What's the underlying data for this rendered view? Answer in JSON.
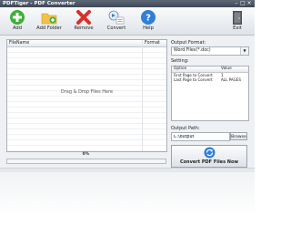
{
  "window": {
    "title": "PDFTiger - PDF Converter"
  },
  "toolbar": {
    "add": "Add",
    "add_folder": "Add Folder",
    "remove": "Remove",
    "convert": "Convert",
    "help": "Help",
    "exit": "Exit"
  },
  "file_list": {
    "columns": [
      "FileName",
      "Format"
    ],
    "placeholder": "Drag & Drop Files Here"
  },
  "progress": {
    "label": "0%",
    "value": 0
  },
  "output_format": {
    "label": "Output Format:",
    "value": "Word Files(*.doc)"
  },
  "setting": {
    "label": "Setting:",
    "columns": [
      "Option",
      "Value"
    ],
    "rows": [
      {
        "option": "First Page to Convert",
        "value": "1"
      },
      {
        "option": "Last Page to Convert",
        "value": "ALL PAGES"
      }
    ]
  },
  "output_path": {
    "label": "Output Path:",
    "value": "C:\\output",
    "browse": "Browse"
  },
  "convert_button": {
    "label": "Convert PDF Files Now"
  },
  "colors": {
    "toolbar_bg": "#eef0f3",
    "progress_fill": "#3c8ede",
    "add_green": "#3fae3a",
    "remove_red": "#d6312c",
    "help_blue": "#2f7fd8"
  }
}
